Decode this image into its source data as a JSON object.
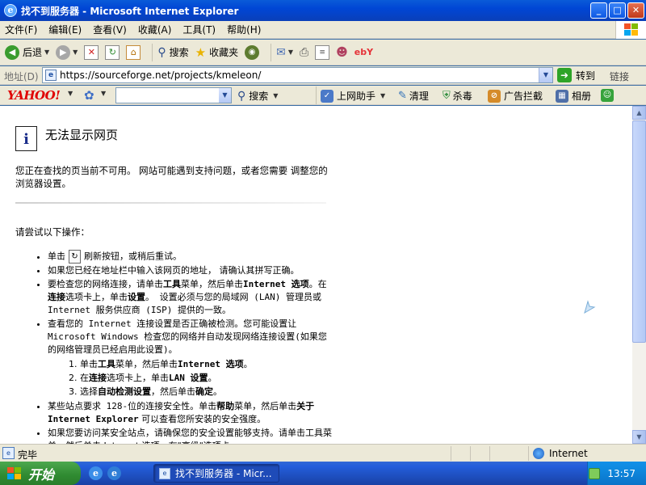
{
  "window": {
    "title": "找不到服务器 - Microsoft Internet Explorer",
    "icon": "ie-icon",
    "controls": {
      "minimize": "_",
      "maximize": "□",
      "close": "✕"
    }
  },
  "menubar": {
    "items": [
      "文件(F)",
      "编辑(E)",
      "查看(V)",
      "收藏(A)",
      "工具(T)",
      "帮助(H)"
    ]
  },
  "toolbar": {
    "back_label": "后退",
    "search_label": "搜索",
    "favorites_label": "收藏夹",
    "ebay_label": "ebY"
  },
  "address": {
    "label": "地址(D)",
    "url": "https://sourceforge.net/projects/kmeleon/",
    "go_label": "转到",
    "links_label": "链接"
  },
  "yahoo_bar": {
    "logo": "YAHOO!",
    "search_placeholder": "",
    "search_label": "搜索",
    "assistant_label": "上网助手",
    "clean_label": "清理",
    "antivirus_label": "杀毒",
    "adblock_label": "广告拦截",
    "album_label": "相册"
  },
  "page": {
    "error_title": "无法显示网页",
    "description": "您正在查找的页当前不可用。 网站可能遇到支持问题，或者您需要 调整您的浏览器设置。",
    "try_heading": "请尝试以下操作：",
    "tips": {
      "t1_pre": "单击",
      "t1_post": "刷新按钮，或稍后重试。",
      "t2": "如果您已经在地址栏中输入该网页的地址， 请确认其拼写正确。",
      "t3_a": "要检查您的网络连接，请单击",
      "t3_b": "工具",
      "t3_c": "菜单，然后单击",
      "t3_d": "Internet 选项",
      "t3_e": "。在",
      "t3_f": "连接",
      "t3_g": "选项卡上，单击",
      "t3_h": "设置",
      "t3_i": "。 设置必须与您的局域网 (LAN) 管理员或 Internet 服务供应商 (ISP) 提供的一致。",
      "t4": "查看您的 Internet 连接设置是否正确被检测。您可能设置让 Microsoft Windows 检查您的网络并自动发现网络连接设置(如果您的网络管理员已经启用此设置)。",
      "s1_a": "单击",
      "s1_b": "工具",
      "s1_c": "菜单，然后单击",
      "s1_d": "Internet 选项",
      "s1_e": "。",
      "s2_a": "在",
      "s2_b": "连接",
      "s2_c": "选项卡上，单击",
      "s2_d": "LAN 设置",
      "s2_e": "。",
      "s3_a": "选择",
      "s3_b": "自动检测设置",
      "s3_c": "，然后单击",
      "s3_d": "确定",
      "s3_e": "。",
      "t5_a": "某些站点要求 128-位的连接安全性。单击",
      "t5_b": "帮助",
      "t5_c": "菜单，然后单击",
      "t5_d": "关于 Internet Explorer",
      "t5_e": " 可以查看您所安装的安全强度。",
      "t6": "如果您要访问某安全站点，请确保您的安全设置能够支持。请单击工具菜单，然后单击 Internet 选项。在\"高级\"选项卡"
    }
  },
  "status": {
    "text": "完毕",
    "zone": "Internet"
  },
  "taskbar": {
    "start_label": "开始",
    "task_label": "找不到服务器 - Micr...",
    "clock": "13:57"
  },
  "colors": {
    "titlebar": "#0a3fb8",
    "chrome": "#ece9d8",
    "start_green": "#2f8a31",
    "yahoo_red": "#e00000"
  }
}
